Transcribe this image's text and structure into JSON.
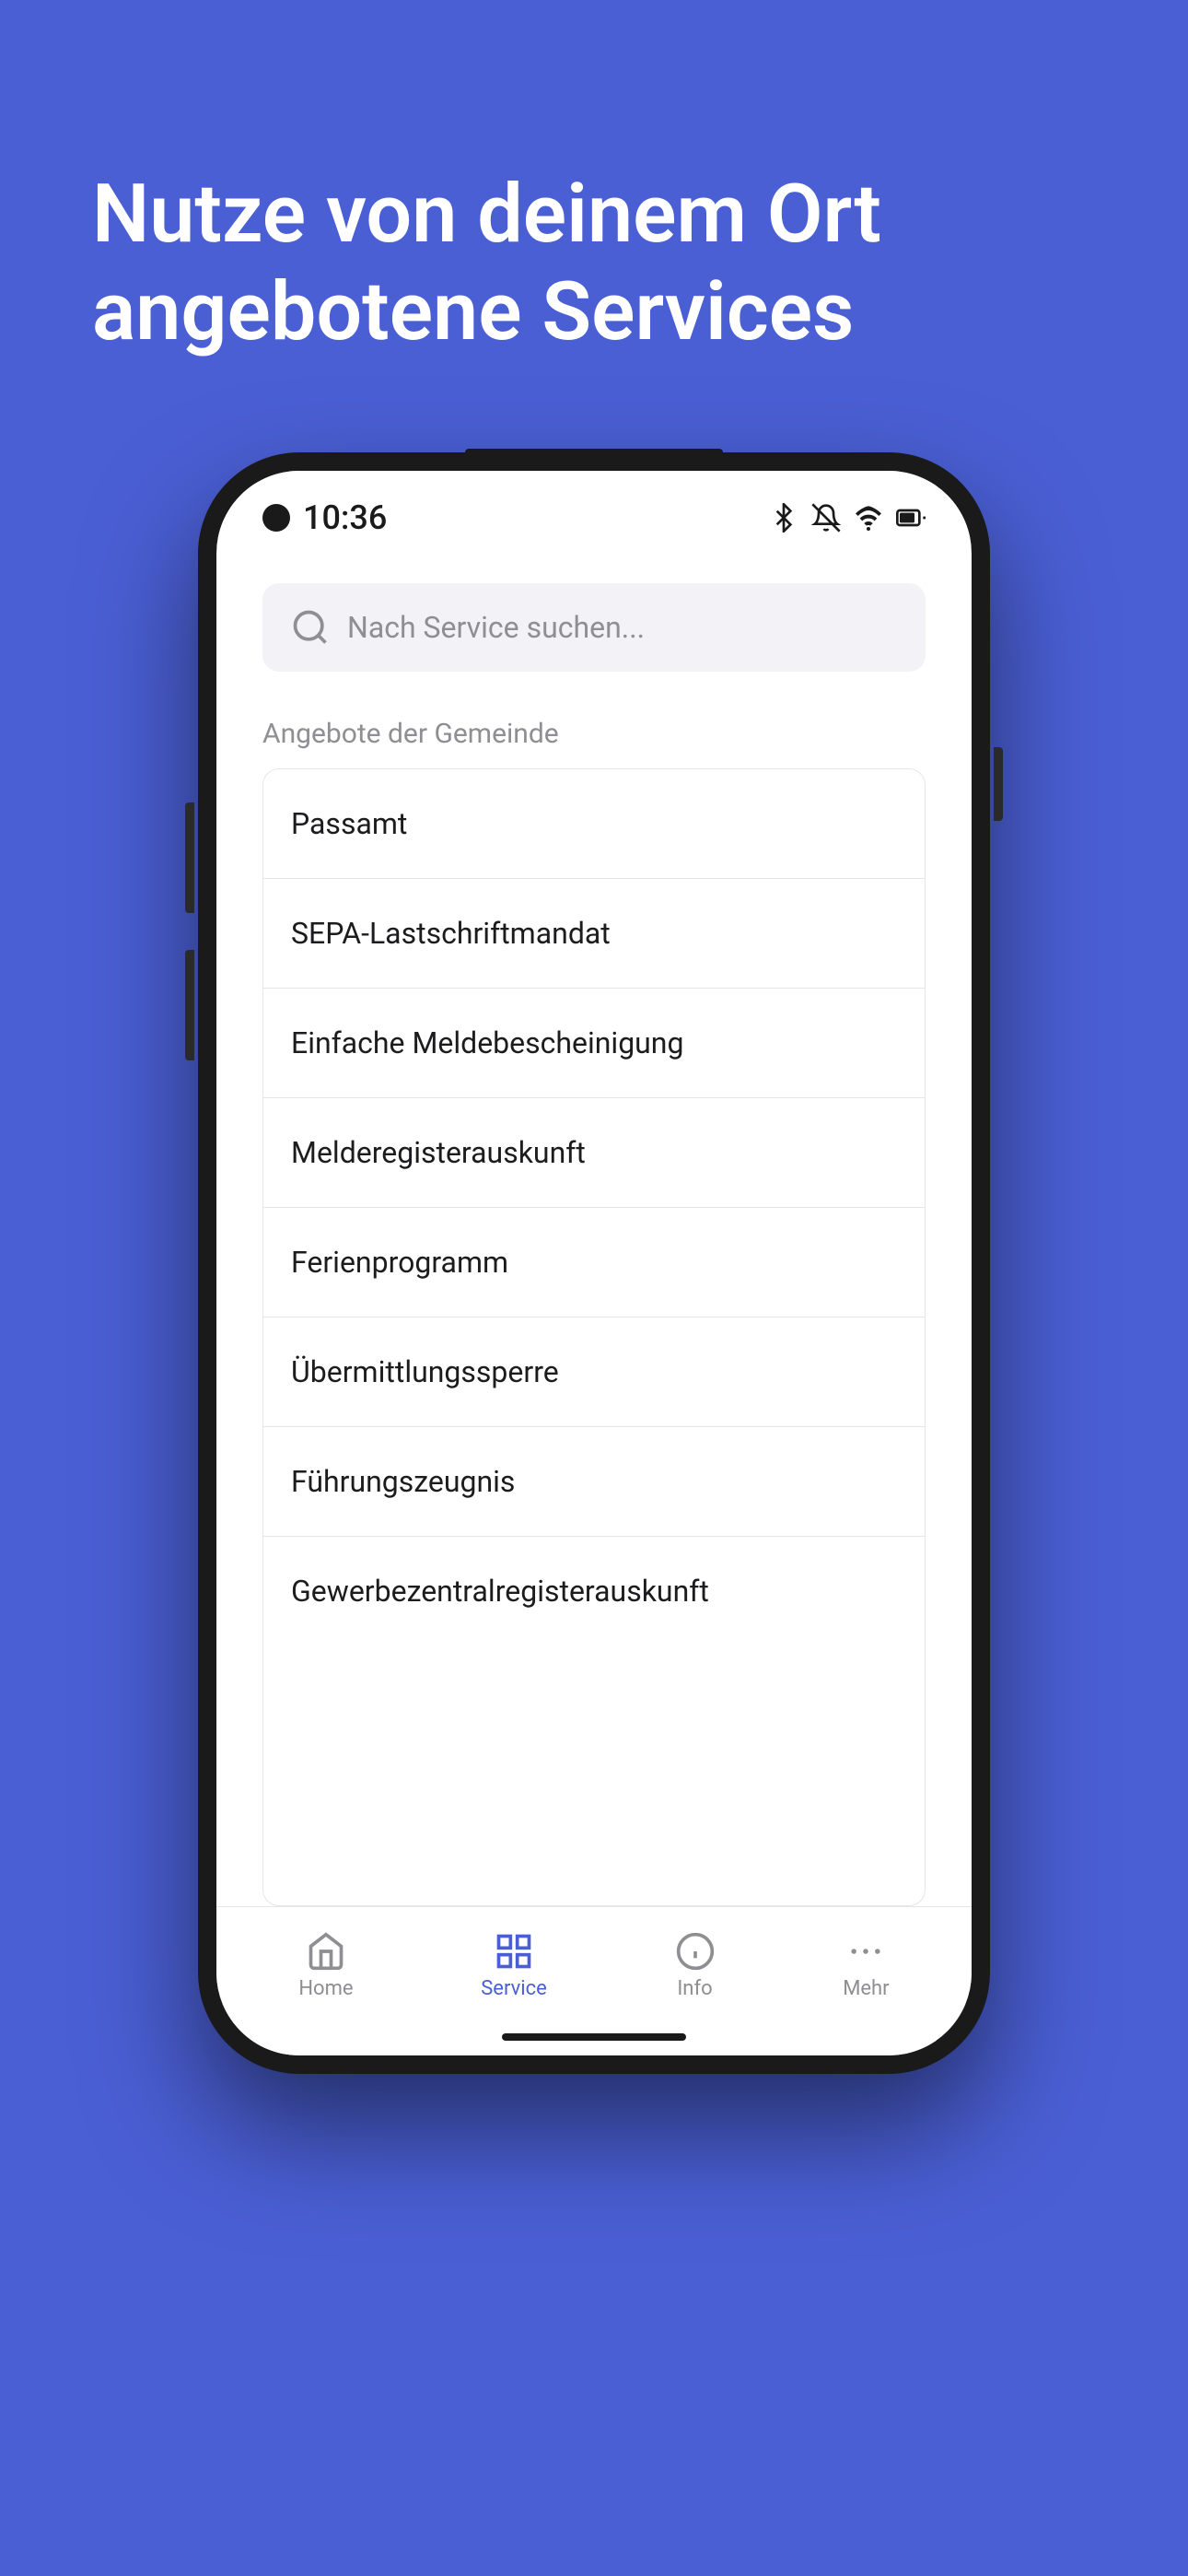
{
  "background_color": "#4a5fd4",
  "hero": {
    "title": "Nutze von deinem Ort angebotene Services"
  },
  "phone": {
    "status_bar": {
      "time": "10:36"
    },
    "search": {
      "placeholder": "Nach Service suchen..."
    },
    "section_label": "Angebote der Gemeinde",
    "service_items": [
      {
        "id": 1,
        "label": "Passamt"
      },
      {
        "id": 2,
        "label": "SEPA-Lastschriftmandat"
      },
      {
        "id": 3,
        "label": "Einfache Meldebescheinigung"
      },
      {
        "id": 4,
        "label": "Melderegisterauskunft"
      },
      {
        "id": 5,
        "label": "Ferienprogramm"
      },
      {
        "id": 6,
        "label": "Übermittlungssperre"
      },
      {
        "id": 7,
        "label": "Führungszeugnis"
      },
      {
        "id": 8,
        "label": "Gewerbezentralregisterauskunft"
      }
    ],
    "bottom_nav": {
      "items": [
        {
          "id": "home",
          "label": "Home",
          "active": false
        },
        {
          "id": "service",
          "label": "Service",
          "active": true
        },
        {
          "id": "info",
          "label": "Info",
          "active": false
        },
        {
          "id": "mehr",
          "label": "Mehr",
          "active": false
        }
      ]
    }
  }
}
